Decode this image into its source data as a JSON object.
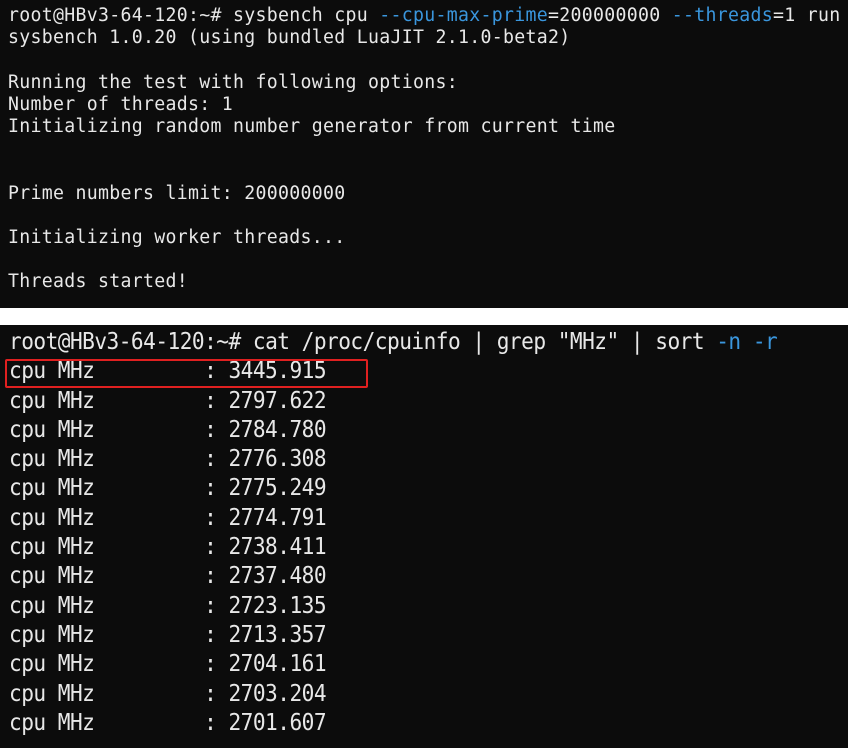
{
  "terminal1": {
    "prompt": "root@HBv3-64-120:~# ",
    "cmd_start": "sysbench cpu ",
    "flag1": "--cpu-max-prime",
    "val1": "=200000000 ",
    "flag2": "--threads",
    "val2": "=1 run",
    "lines": {
      "version": "sysbench 1.0.20 (using bundled LuaJIT 2.1.0-beta2)",
      "running": "Running the test with following options:",
      "threads": "Number of threads: 1",
      "init_rng": "Initializing random number generator from current time",
      "prime_limit": "Prime numbers limit: 200000000",
      "init_workers": "Initializing worker threads...",
      "started": "Threads started!"
    }
  },
  "terminal2": {
    "prompt": "root@HBv3-64-120:~# ",
    "cmd": "cat /proc/cpuinfo | grep \"MHz\" | sort ",
    "flag_n": "-n",
    "space": " ",
    "flag_r": "-r",
    "rows": [
      "cpu MHz         : 3445.915",
      "cpu MHz         : 2797.622",
      "cpu MHz         : 2784.780",
      "cpu MHz         : 2776.308",
      "cpu MHz         : 2775.249",
      "cpu MHz         : 2774.791",
      "cpu MHz         : 2738.411",
      "cpu MHz         : 2737.480",
      "cpu MHz         : 2723.135",
      "cpu MHz         : 2713.357",
      "cpu MHz         : 2704.161",
      "cpu MHz         : 2703.204",
      "cpu MHz         : 2701.607"
    ]
  },
  "colors": {
    "terminal_bg": "#0c0c0c",
    "text": "#e8e8e8",
    "flag": "#3a96dd",
    "highlight": "#e02020"
  }
}
